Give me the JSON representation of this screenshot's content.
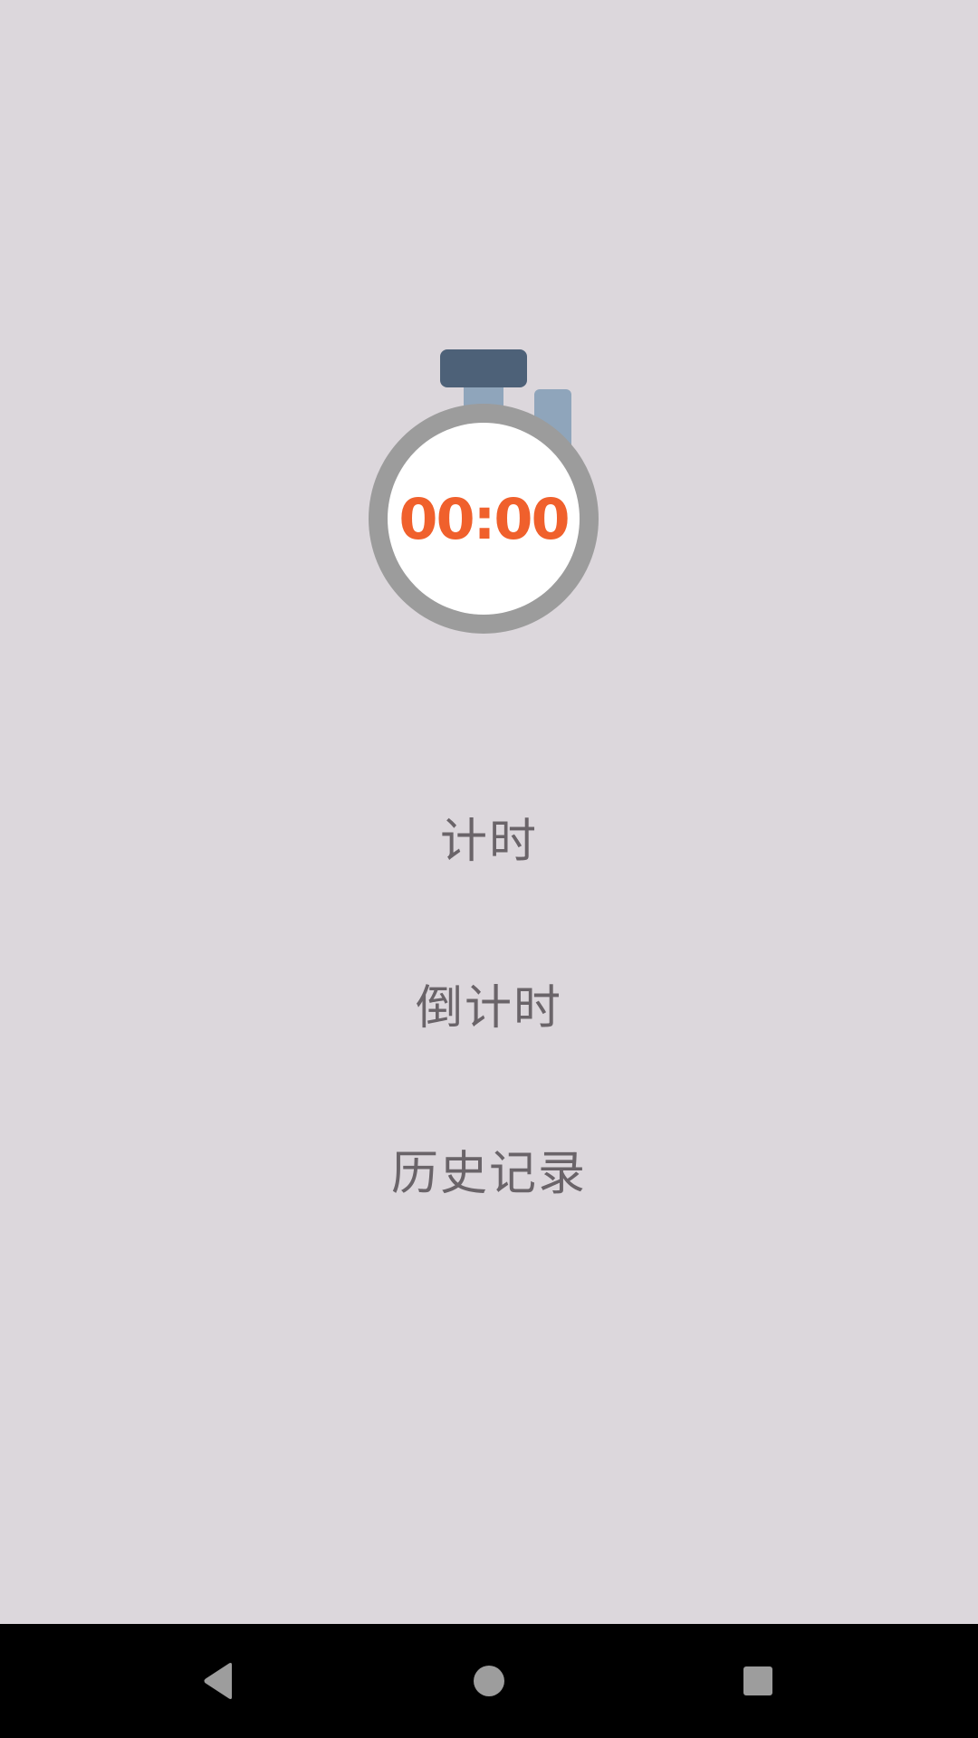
{
  "logo": {
    "icon": "stopwatch-icon",
    "display_text": "00:00",
    "colors": {
      "ring": "#9c9c9c",
      "face": "#ffffff",
      "digits": "#f0602c",
      "crown": "#4d6178",
      "stem": "#8fa5bb"
    }
  },
  "menu": {
    "timer_label": "计时",
    "countdown_label": "倒计时",
    "history_label": "历史记录",
    "text_color": "#6a6469"
  },
  "navbar": {
    "back_icon": "back-triangle-icon",
    "home_icon": "home-circle-icon",
    "recents_icon": "recents-square-icon"
  },
  "background_color": "#dcd7dc"
}
